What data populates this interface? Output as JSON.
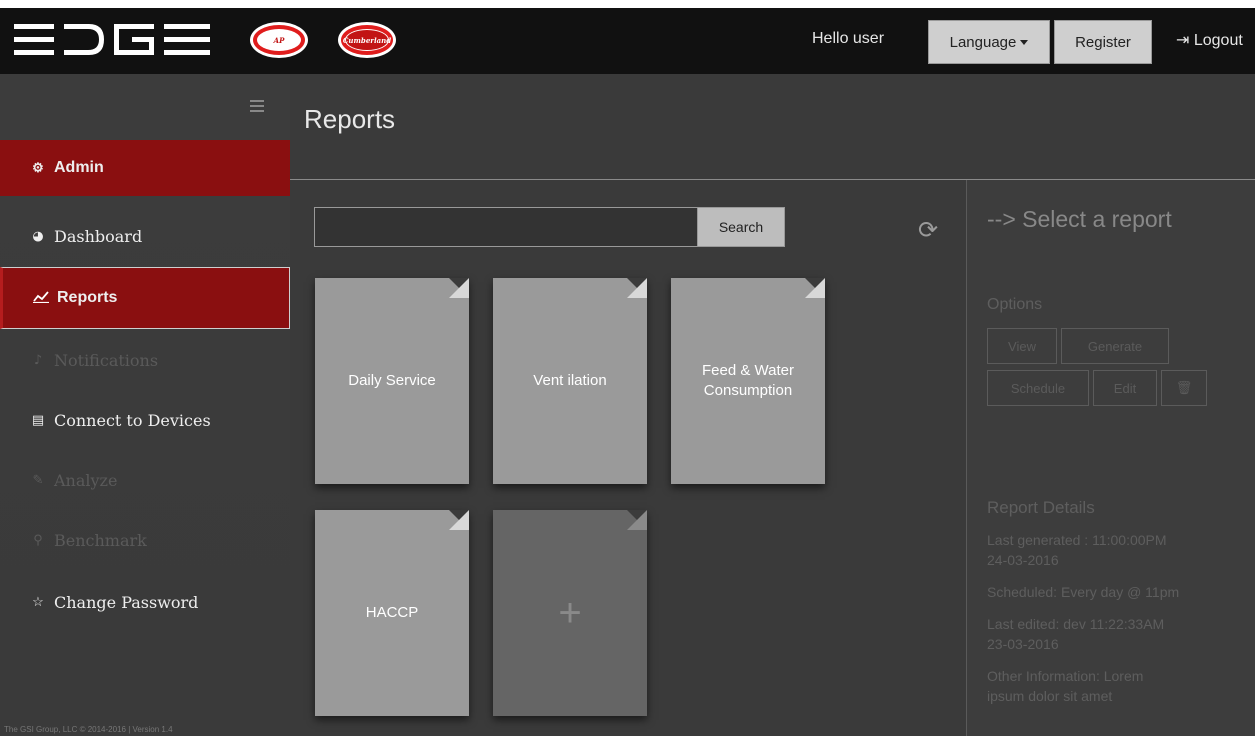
{
  "header": {
    "greeting": "Hello user",
    "language_label": "Language",
    "register_label": "Register",
    "logout_label": "Logout",
    "logo_text": "EDGE",
    "badge_left_text": "AP",
    "badge_right_text": "Cumberland"
  },
  "sidebar": {
    "items": [
      {
        "label": "Admin",
        "icon": "gear-icon"
      },
      {
        "label": "Dashboard",
        "icon": "pie-chart-icon"
      },
      {
        "label": "Reports",
        "icon": "line-chart-icon"
      },
      {
        "label": "Notifications",
        "icon": "bell-icon"
      },
      {
        "label": "Connect to Devices",
        "icon": "keyboard-icon"
      },
      {
        "label": "Analyze",
        "icon": "pencil-icon"
      },
      {
        "label": "Benchmark",
        "icon": "map-pin-icon"
      },
      {
        "label": "Change Password",
        "icon": "star-icon"
      }
    ],
    "footer": "The GSI Group, LLC © 2014-2016 | Version 1.4"
  },
  "main": {
    "title": "Reports",
    "search_value": "",
    "search_button": "Search",
    "cards": [
      {
        "line1": "Daily Service",
        "line2": ""
      },
      {
        "line1": "Vent ilation",
        "line2": ""
      },
      {
        "line1": "Feed & Water",
        "line2": "Consumption"
      },
      {
        "line1": "HACCP",
        "line2": ""
      }
    ],
    "add_symbol": "+"
  },
  "panel": {
    "title": "--> Select a report",
    "options_label": "Options",
    "buttons": {
      "view": "View",
      "generate": "Generate",
      "schedule": "Schedule",
      "edit": "Edit",
      "delete_icon": "trash-icon"
    },
    "details_label": "Report Details",
    "last_generated": "Last generated : 11:00:00PM",
    "last_generated_date": "24-03-2016",
    "scheduled": "Scheduled: Every day @ 11pm",
    "last_edited": "Last edited: dev 11:22:33AM",
    "last_edited_date": "23-03-2016",
    "other_info": "Other Information: Lorem",
    "other_info_2": "ipsum dolor sit amet"
  },
  "colors": {
    "accent_red": "#8a0f10",
    "topbar": "#111111",
    "background": "#3a3a3a",
    "card": "#9a9a9a"
  }
}
